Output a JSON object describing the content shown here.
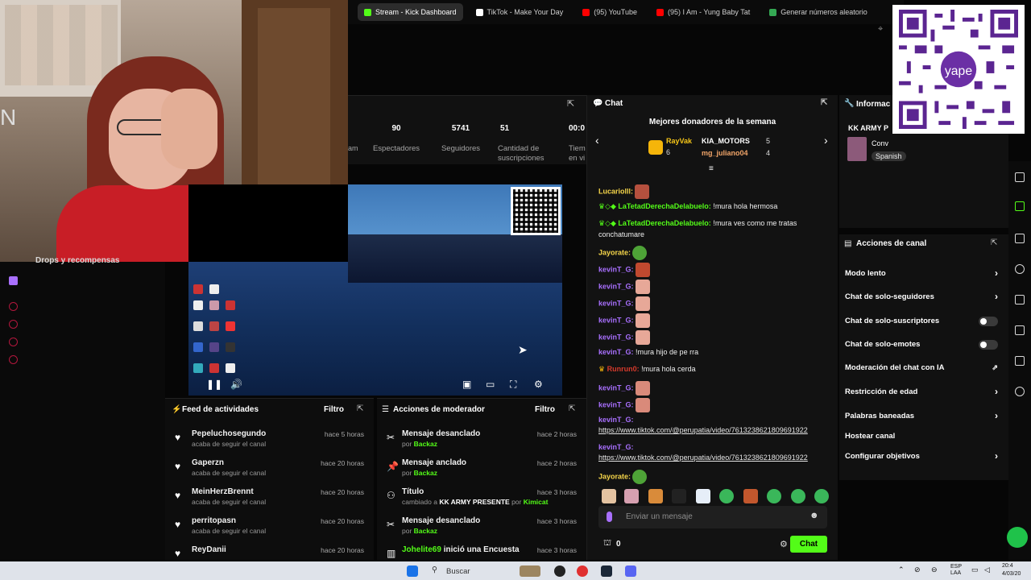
{
  "browser_tabs": [
    {
      "label": "Stream - Kick Dashboard",
      "color": "#53fc18",
      "active": true
    },
    {
      "label": "TikTok - Make Your Day",
      "color": "#ffffff",
      "active": false
    },
    {
      "label": "(95) YouTube",
      "color": "#ff0000",
      "active": false
    },
    {
      "label": "(95) I Am - Yung Baby Tat",
      "color": "#ff0000",
      "active": false
    },
    {
      "label": "Generar números aleatorio",
      "color": "#34a853",
      "active": false
    }
  ],
  "webcam": {
    "letter": "N"
  },
  "stats": [
    {
      "value": "90",
      "label": "Espectadores"
    },
    {
      "value": "5741",
      "label": "Seguidores"
    },
    {
      "value": "51",
      "label": "Cantidad de suscripciones"
    },
    {
      "value": "00:0",
      "label": "Tiem en vi"
    }
  ],
  "stats_partial_label": "am",
  "sidebar": {
    "drops_label": "Drops y recompensas"
  },
  "activity_feed": {
    "title": "Feed de actividades",
    "filter_label": "Filtro",
    "items": [
      {
        "name": "Pepeluchosegundo",
        "action": "acaba de seguir el canal",
        "time": "hace 5 horas"
      },
      {
        "name": "Gaperzn",
        "action": "acaba de seguir el canal",
        "time": "hace 20 horas"
      },
      {
        "name": "MeinHerzBrennt",
        "action": "acaba de seguir el canal",
        "time": "hace 20 horas"
      },
      {
        "name": "perritopasn",
        "action": "acaba de seguir el canal",
        "time": "hace 20 horas"
      },
      {
        "name": "ReyDanii",
        "action": "",
        "time": "hace 20 horas"
      }
    ]
  },
  "mod_actions": {
    "title": "Acciones de moderador",
    "filter_label": "Filtro",
    "items": [
      {
        "title": "Mensaje desanclado",
        "sub_prefix": "por",
        "sub_user": "Backaz",
        "time": "hace 2 horas"
      },
      {
        "title": "Mensaje anclado",
        "sub_prefix": "por",
        "sub_user": "Backaz",
        "time": "hace 2 horas"
      },
      {
        "title": "Título",
        "sub_prefix": "cambiado a",
        "sub_value": "KK ARMY PRESENTE",
        "sub_mid": "por",
        "sub_user": "Kimicat",
        "time": "hace 3 horas"
      },
      {
        "title": "Mensaje desanclado",
        "sub_prefix": "por",
        "sub_user": "Backaz",
        "time": "hace 3 horas"
      },
      {
        "user": "Johelite69",
        "title": "inició una Encuesta",
        "time": "hace 3 horas"
      }
    ]
  },
  "chat": {
    "title": "Chat",
    "donors_title": "Mejores donadores de la semana",
    "donors": [
      {
        "name": "RayVak",
        "amount": "6"
      },
      {
        "name": "KIA_MOTORS",
        "amount": "5"
      },
      {
        "name": "mg_juliano04",
        "amount": "4"
      }
    ],
    "messages": [
      {
        "user": "Lucariolll:",
        "color": "#f6d64a",
        "text": ""
      },
      {
        "user": "LaTetadDerechaDelabuelo:",
        "color": "#53fc18",
        "text": "!mura hola hermosa"
      },
      {
        "user": "LaTetadDerechaDelabuelo:",
        "color": "#53fc18",
        "text": "!mura ves como me tratas"
      },
      {
        "user": "",
        "color": "#ffffff",
        "text": "conchatumare"
      },
      {
        "user": "Jayorate:",
        "color": "#f6d64a",
        "text": ""
      },
      {
        "user": "kevinT_G:",
        "color": "#a970ff",
        "text": ""
      },
      {
        "user": "kevinT_G:",
        "color": "#a970ff",
        "text": ""
      },
      {
        "user": "kevinT_G:",
        "color": "#a970ff",
        "text": ""
      },
      {
        "user": "kevinT_G:",
        "color": "#a970ff",
        "text": ""
      },
      {
        "user": "kevinT_G:",
        "color": "#a970ff",
        "text": ""
      },
      {
        "user": "kevinT_G:",
        "color": "#a970ff",
        "text": "!mura hijo de pe rra"
      },
      {
        "user": "Runrun0:",
        "color": "#d63a2c",
        "text": "!mura hola cerda"
      },
      {
        "user": "kevinT_G:",
        "color": "#a970ff",
        "text": ""
      },
      {
        "user": "kevinT_G:",
        "color": "#a970ff",
        "text": ""
      },
      {
        "user": "kevinT_G:",
        "color": "#a970ff",
        "text": ""
      },
      {
        "user": "",
        "color": "#ffffff",
        "text": "https://www.tiktok.com/@perupatia/video/761323862180969192​2"
      },
      {
        "user": "kevinT_G:",
        "color": "#a970ff",
        "text": ""
      },
      {
        "user": "",
        "color": "#ffffff",
        "text": "https://www.tiktok.com/@perupatia/video/761323862180969192​2"
      },
      {
        "user": "Jayorate:",
        "color": "#f6d64a",
        "text": ""
      }
    ],
    "input_placeholder": "Enviar un mensaje",
    "points": "0",
    "send_label": "Chat"
  },
  "info_panel": {
    "title": "Informac",
    "stream_title": "KK ARMY P",
    "category": "Conv",
    "language": "Spanish"
  },
  "channel_actions": {
    "title": "Acciones de canal",
    "items": [
      {
        "label": "Modo lento",
        "control": "chevron"
      },
      {
        "label": "Chat de solo-seguidores",
        "control": "chevron"
      },
      {
        "label": "Chat de solo-suscriptores",
        "control": "toggle"
      },
      {
        "label": "Chat de solo-emotes",
        "control": "toggle"
      },
      {
        "label": "Moderación del chat con IA",
        "control": "external"
      },
      {
        "label": "Restricción de edad",
        "control": "chevron"
      },
      {
        "label": "Palabras baneadas",
        "control": "chevron"
      },
      {
        "label": "Hostear canal",
        "control": "none"
      },
      {
        "label": "Configurar objetivos",
        "control": "chevron"
      }
    ]
  },
  "qr_brand": "yape",
  "taskbar": {
    "search_label": "Buscar",
    "lang": "ESP LAA",
    "time": "20:4",
    "date": "4/03/20"
  },
  "colors": {
    "accent": "#53fc18",
    "panel": "#111111",
    "purple": "#a970ff"
  }
}
